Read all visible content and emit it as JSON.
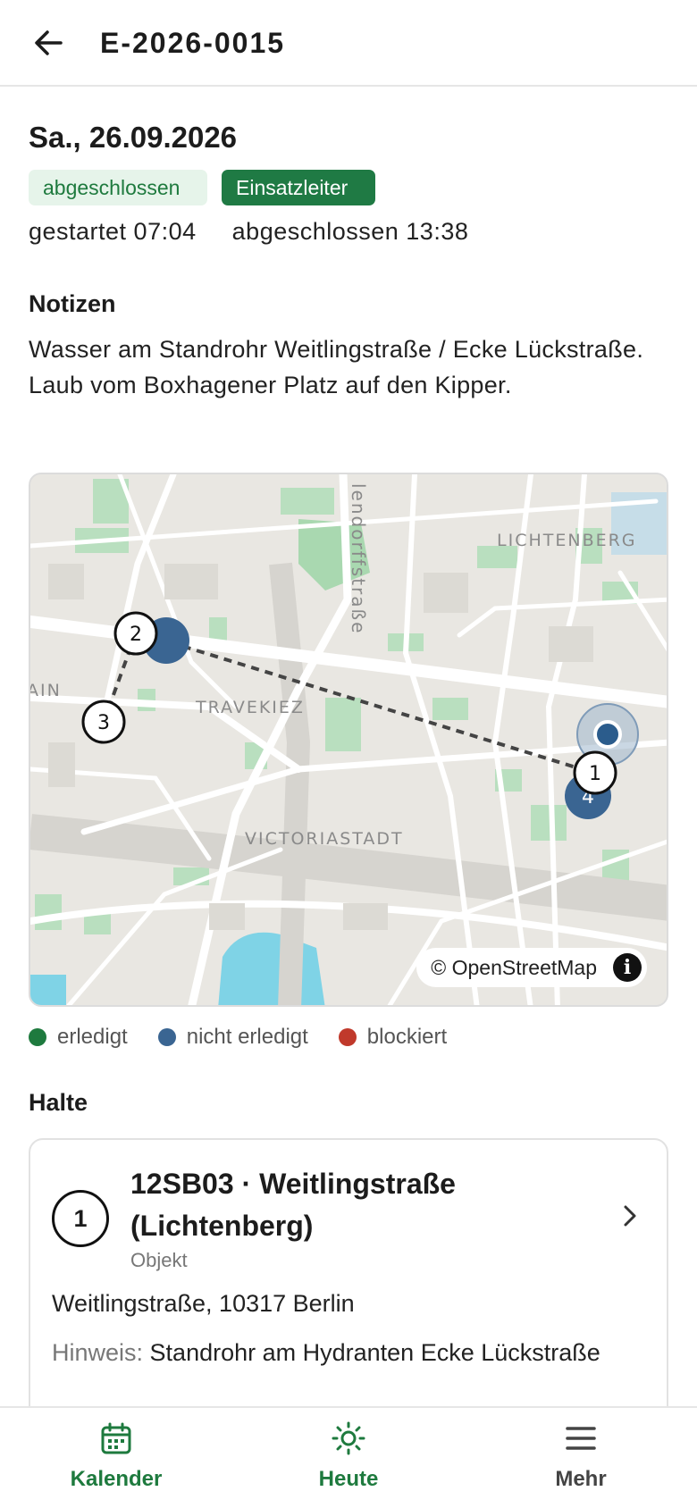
{
  "header": {
    "title": "E-2026-0015",
    "back_icon": "arrow-left-icon"
  },
  "detail": {
    "date": "Sa., 26.09.2026",
    "status_badge": "abgeschlossen",
    "role_badge": "Einsatzleiter",
    "started": "gestartet 07:04",
    "finished": "abgeschlossen 13:38"
  },
  "notes": {
    "heading": "Notizen",
    "text": "Wasser am Standrohr Weitlingstraße / Ecke Lückstraße. Laub vom Boxhagener Platz auf den Kipper."
  },
  "map": {
    "labels": {
      "street": "lendorffstraße",
      "district1": "LICHTENBERG",
      "district2": "TRAVEKIEZ",
      "district3": "VICTORIASTADT",
      "edge": "AIN"
    },
    "attribution": "© OpenStreetMap",
    "info_glyph": "i",
    "markers": [
      "1",
      "2",
      "3",
      "4"
    ]
  },
  "legend": [
    {
      "label": "erledigt",
      "color": "#1e7a3e"
    },
    {
      "label": "nicht erledigt",
      "color": "#3a6592"
    },
    {
      "label": "blockiert",
      "color": "#c0392b"
    }
  ],
  "stops": {
    "heading": "Halte",
    "items": [
      {
        "number": "1",
        "name": "12SB03 · Weitlingstraße (Lichtenberg)",
        "type": "Objekt",
        "address": "Weitlingstraße, 10317 Berlin",
        "hint_label": "Hinweis:",
        "hint": "Standrohr am Hydranten Ecke Lückstraße"
      }
    ]
  },
  "nav": {
    "items": [
      {
        "label": "Kalender",
        "icon": "calendar-icon",
        "color": "#1e7a3e"
      },
      {
        "label": "Heute",
        "icon": "sun-icon",
        "color": "#1e7a3e",
        "active": true
      },
      {
        "label": "Mehr",
        "icon": "menu-icon",
        "color": "#444444"
      }
    ]
  },
  "colors": {
    "accent": "#1e7a3e",
    "marker_blue": "#3a6592"
  }
}
